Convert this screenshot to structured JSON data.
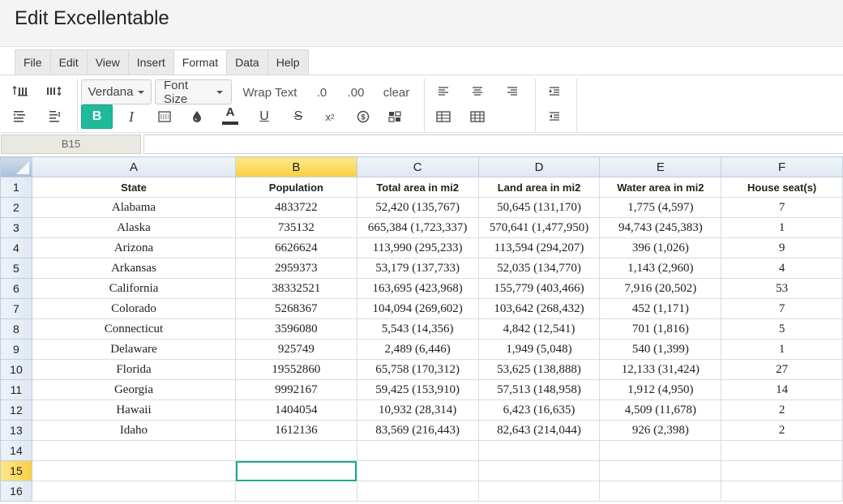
{
  "window": {
    "title": "Edit Excellentable"
  },
  "menu": {
    "items": [
      {
        "label": "File",
        "active": false
      },
      {
        "label": "Edit",
        "active": false
      },
      {
        "label": "View",
        "active": false
      },
      {
        "label": "Insert",
        "active": false
      },
      {
        "label": "Format",
        "active": true
      },
      {
        "label": "Data",
        "active": false
      },
      {
        "label": "Help",
        "active": false
      }
    ]
  },
  "toolbar": {
    "font_family": "Verdana",
    "font_size": "Font Size",
    "wrap_text": "Wrap Text",
    "decimal_one": ".0",
    "decimal_two": ".00",
    "clear": "clear",
    "bold": "B",
    "italic": "I",
    "text_color": "A",
    "underline": "U",
    "strikethrough": "S",
    "accent_color": "#1fb99b"
  },
  "formula_bar": {
    "cell_ref": "B15",
    "value": ""
  },
  "sheet": {
    "columns": [
      "A",
      "B",
      "C",
      "D",
      "E",
      "F"
    ],
    "selected_column": "B",
    "selected_row": "15",
    "active_cell": "B15",
    "rows": [
      {
        "num": "1",
        "cells": [
          "State",
          "Population",
          "Total area in mi2",
          "Land area in mi2",
          "Water area in mi2",
          "House seat(s)"
        ],
        "header": true
      },
      {
        "num": "2",
        "cells": [
          "Alabama",
          "4833722",
          "52,420 (135,767)",
          "50,645 (131,170)",
          "1,775 (4,597)",
          "7"
        ]
      },
      {
        "num": "3",
        "cells": [
          "Alaska",
          "735132",
          "665,384 (1,723,337)",
          "570,641 (1,477,950)",
          "94,743 (245,383)",
          "1"
        ]
      },
      {
        "num": "4",
        "cells": [
          "Arizona",
          "6626624",
          "113,990 (295,233)",
          "113,594 (294,207)",
          "396 (1,026)",
          "9"
        ]
      },
      {
        "num": "5",
        "cells": [
          "Arkansas",
          "2959373",
          "53,179 (137,733)",
          "52,035 (134,770)",
          "1,143 (2,960)",
          "4"
        ]
      },
      {
        "num": "6",
        "cells": [
          "California",
          "38332521",
          "163,695 (423,968)",
          "155,779 (403,466)",
          "7,916 (20,502)",
          "53"
        ]
      },
      {
        "num": "7",
        "cells": [
          "Colorado",
          "5268367",
          "104,094 (269,602)",
          "103,642 (268,432)",
          "452 (1,171)",
          "7"
        ]
      },
      {
        "num": "8",
        "cells": [
          "Connecticut",
          "3596080",
          "5,543 (14,356)",
          "4,842 (12,541)",
          "701 (1,816)",
          "5"
        ]
      },
      {
        "num": "9",
        "cells": [
          "Delaware",
          "925749",
          "2,489 (6,446)",
          "1,949 (5,048)",
          "540 (1,399)",
          "1"
        ]
      },
      {
        "num": "10",
        "cells": [
          "Florida",
          "19552860",
          "65,758 (170,312)",
          "53,625 (138,888)",
          "12,133 (31,424)",
          "27"
        ]
      },
      {
        "num": "11",
        "cells": [
          "Georgia",
          "9992167",
          "59,425 (153,910)",
          "57,513 (148,958)",
          "1,912 (4,950)",
          "14"
        ]
      },
      {
        "num": "12",
        "cells": [
          "Hawaii",
          "1404054",
          "10,932 (28,314)",
          "6,423 (16,635)",
          "4,509 (11,678)",
          "2"
        ]
      },
      {
        "num": "13",
        "cells": [
          "Idaho",
          "1612136",
          "83,569 (216,443)",
          "82,643 (214,044)",
          "926 (2,398)",
          "2"
        ]
      },
      {
        "num": "14",
        "cells": [
          "",
          "",
          "",
          "",
          "",
          ""
        ]
      },
      {
        "num": "15",
        "cells": [
          "",
          "",
          "",
          "",
          "",
          ""
        ]
      },
      {
        "num": "16",
        "cells": [
          "",
          "",
          "",
          "",
          "",
          ""
        ]
      }
    ]
  }
}
